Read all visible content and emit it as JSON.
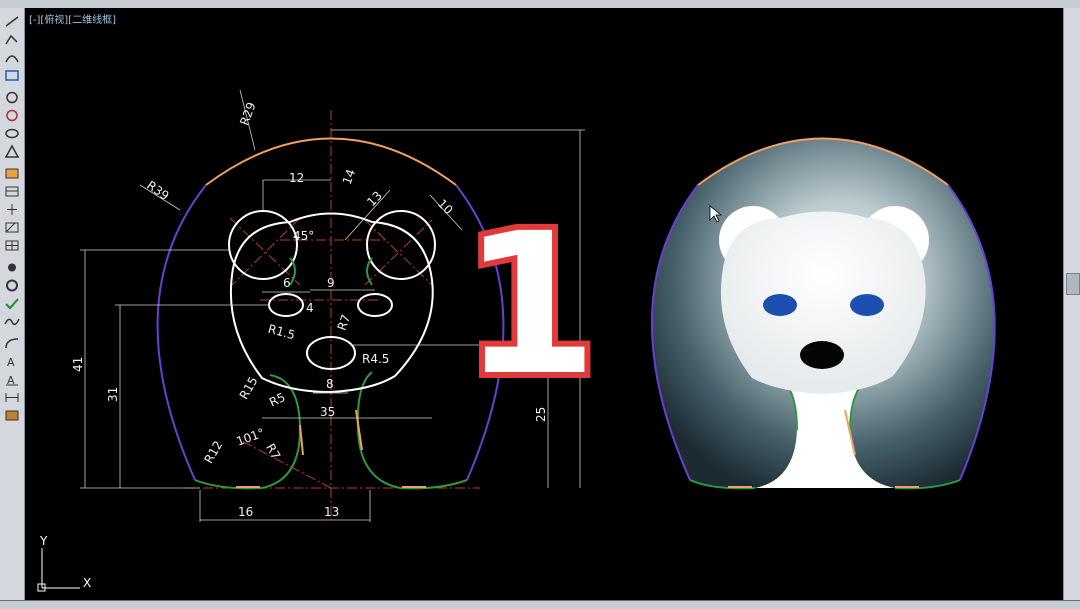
{
  "viewport": {
    "label": "[-][俯视][二维线框]"
  },
  "ucs": {
    "x_label": "X",
    "y_label": "Y"
  },
  "badge": {
    "number": "1",
    "fill": "#ffffff",
    "outline": "#e23a3a"
  },
  "dimensions": {
    "r29": "R29",
    "r39": "R39",
    "d12": "12",
    "d14": "14",
    "d13": "13",
    "d10": "10",
    "a45": "45°",
    "d6": "6",
    "d9": "9",
    "d4": "4",
    "r7": "R7",
    "r15": "R1.5",
    "r45": "R4.5",
    "d8": "8",
    "r15b": "R15",
    "r5": "R5",
    "d35": "35",
    "d41": "41",
    "d31": "31",
    "d25": "25",
    "r12": "R12",
    "a101": "101°",
    "r7b": "R7",
    "d16": "16",
    "d13b": "13"
  },
  "colors": {
    "outline": "#ffffff",
    "arc_orange": "#f0a060",
    "arc_purple": "#6a3fd0",
    "arc_green": "#2e9a3e",
    "center": "#c0392b",
    "dim": "#cfcfcf"
  }
}
